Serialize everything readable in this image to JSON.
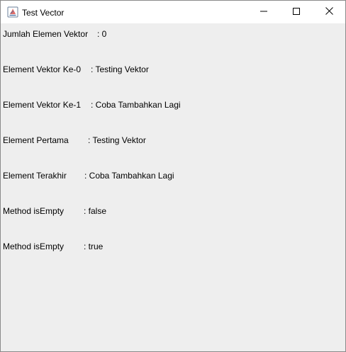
{
  "window": {
    "title": "Test Vector"
  },
  "rows": [
    {
      "label": "Jumlah Elemen Vektor",
      "value": ": 0"
    },
    {
      "label": "Element Vektor Ke-0",
      "value": ": Testing Vektor"
    },
    {
      "label": "Element Vektor Ke-1",
      "value": ": Coba Tambahkan Lagi"
    },
    {
      "label": "Element Pertama",
      "value": ": Testing Vektor"
    },
    {
      "label": "Element Terakhir",
      "value": ": Coba Tambahkan Lagi"
    },
    {
      "label": "Method isEmpty",
      "value": ": false"
    },
    {
      "label": "Method isEmpty",
      "value": ": true"
    }
  ],
  "icons": {
    "app": "java-app-icon",
    "minimize": "minimize-icon",
    "maximize": "maximize-icon",
    "close": "close-icon"
  }
}
